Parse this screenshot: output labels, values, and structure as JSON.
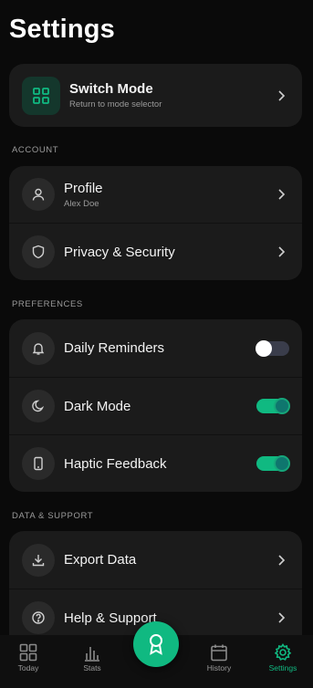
{
  "page": {
    "title": "Settings"
  },
  "switch_mode": {
    "label": "Switch Mode",
    "sub": "Return to mode selector",
    "icon": "grid-icon"
  },
  "account": {
    "section_label": "ACCOUNT",
    "profile": {
      "label": "Profile",
      "sub": "Alex Doe",
      "icon": "user-icon"
    },
    "privacy": {
      "label": "Privacy & Security",
      "icon": "shield-icon"
    }
  },
  "preferences": {
    "section_label": "PREFERENCES",
    "daily_reminders": {
      "label": "Daily Reminders",
      "icon": "bell-icon",
      "enabled": false
    },
    "dark_mode": {
      "label": "Dark Mode",
      "icon": "moon-icon",
      "enabled": true
    },
    "haptic_feedback": {
      "label": "Haptic Feedback",
      "icon": "phone-icon",
      "enabled": true
    }
  },
  "data_support": {
    "section_label": "DATA & SUPPORT",
    "export": {
      "label": "Export Data",
      "icon": "download-icon"
    },
    "help": {
      "label": "Help & Support",
      "icon": "help-icon"
    }
  },
  "nav": {
    "today": "Today",
    "stats": "Stats",
    "history": "History",
    "settings": "Settings",
    "active": "settings"
  },
  "colors": {
    "accent": "#10b981",
    "card": "#1b1b1b",
    "background": "#0a0a0a"
  }
}
